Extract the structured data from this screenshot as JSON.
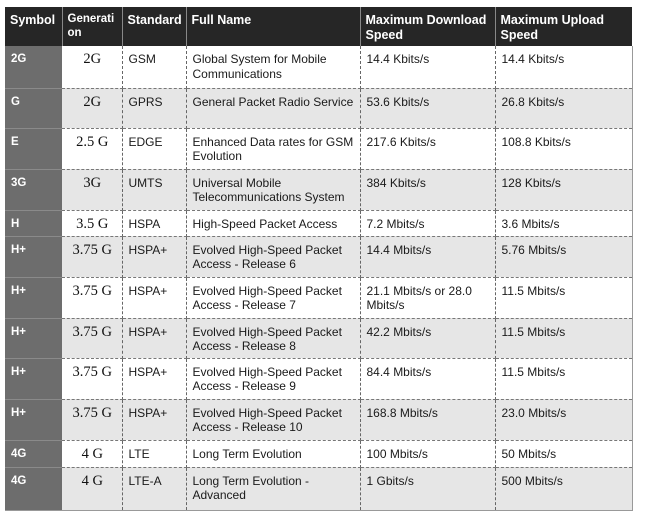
{
  "table": {
    "headers": {
      "symbol": "Symbol",
      "generation": "Generation",
      "standard": "Standard",
      "full_name": "Full Name",
      "max_download": "Maximum Download Speed",
      "max_upload": "Maximum Upload Speed"
    },
    "rows": [
      {
        "symbol": "2G",
        "generation": "2G",
        "standard": "GSM",
        "full_name": "Global System for Mobile Communications",
        "download": "14.4 Kbits/s",
        "upload": "14.4 Kbits/s"
      },
      {
        "symbol": "G",
        "generation": "2G",
        "standard": "GPRS",
        "full_name": "General Packet Radio Service",
        "download": "53.6 Kbits/s",
        "upload": "26.8 Kbits/s"
      },
      {
        "symbol": "E",
        "generation": "2.5 G",
        "standard": "EDGE",
        "full_name": "Enhanced Data rates for GSM Evolution",
        "download": "217.6 Kbits/s",
        "upload": "108.8 Kbits/s"
      },
      {
        "symbol": "3G",
        "generation": "3G",
        "standard": "UMTS",
        "full_name": "Universal Mobile Telecommunications System",
        "download": "384 Kbits/s",
        "upload": "128 Kbits/s"
      },
      {
        "symbol": "H",
        "generation": "3.5 G",
        "standard": "HSPA",
        "full_name": "High-Speed Packet Access",
        "download": "7.2 Mbits/s",
        "upload": "3.6 Mbits/s"
      },
      {
        "symbol": "H+",
        "generation": "3.75 G",
        "standard": "HSPA+",
        "full_name": "Evolved High-Speed Packet Access - Release 6",
        "download": "14.4 Mbits/s",
        "upload": "5.76 Mbits/s"
      },
      {
        "symbol": "H+",
        "generation": "3.75 G",
        "standard": "HSPA+",
        "full_name": "Evolved High-Speed Packet Access - Release 7",
        "download": "21.1 Mbits/s or 28.0 Mbits/s",
        "upload": "11.5 Mbits/s"
      },
      {
        "symbol": "H+",
        "generation": "3.75 G",
        "standard": "HSPA+",
        "full_name": "Evolved High-Speed Packet Access - Release 8",
        "download": "42.2 Mbits/s",
        "upload": "11.5 Mbits/s"
      },
      {
        "symbol": "H+",
        "generation": "3.75 G",
        "standard": "HSPA+",
        "full_name": "Evolved High-Speed Packet Access - Release 9",
        "download": "84.4 Mbits/s",
        "upload": "11.5 Mbits/s"
      },
      {
        "symbol": "H+",
        "generation": "3.75 G",
        "standard": "HSPA+",
        "full_name": "Evolved High-Speed Packet Access - Release 10",
        "download": "168.8 Mbits/s",
        "upload": "23.0 Mbits/s"
      },
      {
        "symbol": "4G",
        "generation": "4 G",
        "standard": "LTE",
        "full_name": "Long Term Evolution",
        "download": "100 Mbits/s",
        "upload": "50 Mbits/s"
      },
      {
        "symbol": "4G",
        "generation": "4 G",
        "standard": "LTE-A",
        "full_name": "Long Term Evolution - Advanced",
        "download": "1 Gbits/s",
        "upload": "500 Mbits/s"
      }
    ]
  }
}
